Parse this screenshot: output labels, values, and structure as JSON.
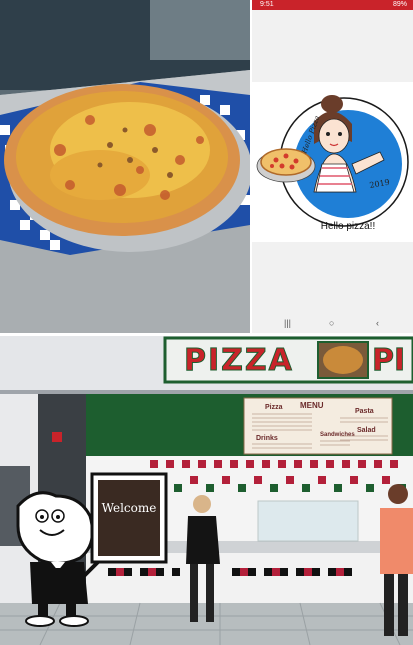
{
  "status_bar": {
    "time": "9:51",
    "battery": "89%"
  },
  "logo": {
    "year": "2019",
    "script_name": "Hello Pizza",
    "caption": "Hello pizza!!"
  },
  "nav": {
    "recents": "|||",
    "home": "○",
    "back": "‹"
  },
  "storefront": {
    "sign_text": "PIZZA",
    "sign_text_repeat": "PI"
  },
  "menu_board": {
    "pizza_heading": "Pizza",
    "menu_heading": "MENU",
    "pasta_heading": "Pasta",
    "drinks_heading": "Drinks",
    "sandwiches_heading": "Sandwiches",
    "salad_heading": "Salad"
  },
  "welcome_sign": {
    "text": "Welcome"
  },
  "colors": {
    "brand_red": "#c9232a",
    "logo_blue": "#1f7fd6",
    "sign_green": "#1d5e2f",
    "checker_red": "#b3203a"
  }
}
